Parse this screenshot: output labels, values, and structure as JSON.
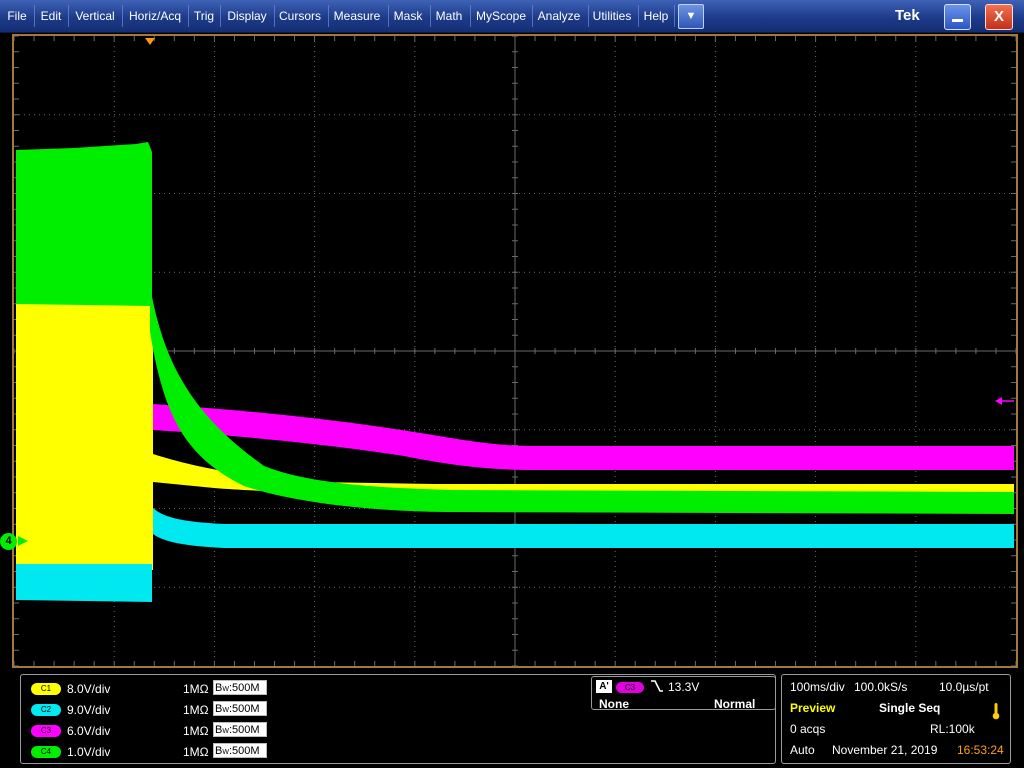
{
  "menu": {
    "items": [
      "File",
      "Edit",
      "Vertical",
      "Horiz/Acq",
      "Trig",
      "Display",
      "Cursors",
      "Measure",
      "Mask",
      "Math",
      "MyScope",
      "Analyze",
      "Utilities",
      "Help"
    ],
    "dropdown_icon": "chevron-down-icon",
    "brand": "Tek",
    "minimize_icon": "minimize-icon",
    "close_label": "X"
  },
  "colors": {
    "c1": "#ffff00",
    "c2": "#00e8f0",
    "c3": "#ff00ff",
    "c4": "#00ee00",
    "graticule_border": "#a07a3c",
    "time_value": "#ff9f1a",
    "preview": "#ffff00"
  },
  "markers": {
    "ground_c4_label": "4",
    "trigger_position_icon": "trigger-position-icon",
    "trigger_level_icon": "trigger-level-arrow-icon"
  },
  "channels": [
    {
      "badge": "C1",
      "scale": "8.0V/div",
      "impedance": "1MΩ",
      "bw_b": "B",
      "bw_w": "W",
      "bw_value": ":500M"
    },
    {
      "badge": "C2",
      "scale": "9.0V/div",
      "impedance": "1MΩ",
      "bw_b": "B",
      "bw_w": "W",
      "bw_value": ":500M"
    },
    {
      "badge": "C3",
      "scale": "6.0V/div",
      "impedance": "1MΩ",
      "bw_b": "B",
      "bw_w": "W",
      "bw_value": ":500M"
    },
    {
      "badge": "C4",
      "scale": "1.0V/div",
      "impedance": "1MΩ",
      "bw_b": "B",
      "bw_w": "W",
      "bw_value": ":500M"
    }
  ],
  "trigger": {
    "type_label": "A'",
    "source_badge": "C3",
    "slope_icon": "falling-edge-icon",
    "level": "13.3V",
    "coupling": "None",
    "mode": "Normal"
  },
  "acquisition": {
    "horizontal_scale": "100ms/div",
    "sample_rate": "100.0kS/s",
    "resolution": "10.0µs/pt",
    "state": "Preview",
    "run_mode": "Single Seq",
    "acqs": "0 acqs",
    "record_length": "RL:100k",
    "trigger_mode": "Auto",
    "date": "November 21, 2019",
    "time": "16:53:24",
    "status_icon": "thermometer-icon"
  }
}
